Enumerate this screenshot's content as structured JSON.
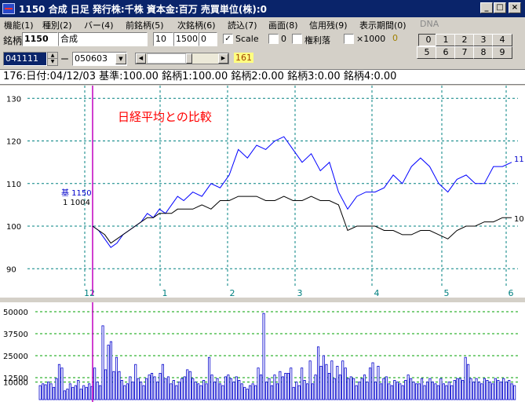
{
  "window": {
    "title": "1150 合成  日足    発行株:千株  資本金:百万  売買単位(株):0",
    "minimize_label": "_",
    "maximize_label": "□",
    "close_label": "×"
  },
  "menu": [
    "機能(1)",
    "種別(2)",
    "バー(4)",
    "前銘柄(5)",
    "次銘柄(6)",
    "読込(7)",
    "画面(8)",
    "信用残(9)",
    "表示期間(0)",
    "DNA"
  ],
  "toolbar": {
    "ticker_label": "銘柄",
    "ticker_code": "1150",
    "ticker_name": "合成",
    "field_a": "10",
    "field_b": "1500",
    "field_c": "0",
    "scale_label": "Scale",
    "scale_checked": "✓",
    "zero_label": "0",
    "rights_label": "権利落",
    "x1000_label": "×1000",
    "count_value": "0",
    "start_date": "041111",
    "dash": "ー",
    "end_date": "050603",
    "slider_value": "161",
    "number_buttons": [
      "0",
      "1",
      "2",
      "3",
      "4",
      "5",
      "6",
      "7",
      "8",
      "9"
    ]
  },
  "info": {
    "text": "176:日付:04/12/03  基準:100.00  銘柄1:100.00  銘柄2:0.00  銘柄3:0.00  銘柄4:0.00"
  },
  "colors": {
    "main_series": "#0000ff",
    "compare_series": "#000000",
    "cursor": "#c000c0",
    "annotation": "#ff0000",
    "grid": "#008080",
    "volume_grid": "#00a000"
  },
  "chart_data": [
    {
      "type": "line",
      "title": "日経平均との比較",
      "ylim": [
        86,
        133
      ],
      "y_ticks": [
        "130",
        "120",
        "110",
        "100",
        "90"
      ],
      "x_ticks": [
        "12",
        "1",
        "2",
        "3",
        "4",
        "5",
        "6"
      ],
      "x_sub_label": "5",
      "legend": [
        "基 1150",
        "1 1004"
      ],
      "end_labels": [
        "11",
        "10"
      ],
      "x_domain": [
        0,
        138
      ],
      "series": [
        {
          "name": "1150",
          "x": [
            0,
            2,
            4,
            6,
            8,
            10,
            12,
            14,
            16,
            18,
            20,
            22,
            24,
            26,
            28,
            30,
            33,
            36,
            39,
            42,
            45,
            48,
            51,
            54,
            57,
            60,
            63,
            66,
            69,
            72,
            75,
            78,
            81,
            84,
            87,
            90,
            93,
            96,
            99,
            102,
            105,
            108,
            111,
            114,
            117,
            120,
            123,
            126,
            129,
            132,
            135,
            138
          ],
          "values": [
            100,
            99,
            97,
            95,
            96,
            98,
            99,
            100,
            101,
            103,
            102,
            104,
            103,
            105,
            107,
            106,
            108,
            107,
            110,
            109,
            112,
            118,
            116,
            119,
            118,
            120,
            121,
            118,
            115,
            117,
            113,
            115,
            108,
            104,
            107,
            108,
            108,
            109,
            112,
            110,
            114,
            116,
            114,
            110,
            108,
            111,
            112,
            110,
            110,
            114,
            114,
            115
          ]
        },
        {
          "name": "1004",
          "x": [
            0,
            2,
            4,
            6,
            8,
            10,
            12,
            14,
            16,
            18,
            20,
            22,
            24,
            26,
            28,
            30,
            33,
            36,
            39,
            42,
            45,
            48,
            51,
            54,
            57,
            60,
            63,
            66,
            69,
            72,
            75,
            78,
            81,
            84,
            87,
            90,
            93,
            96,
            99,
            102,
            105,
            108,
            111,
            114,
            117,
            120,
            123,
            126,
            129,
            132,
            135,
            138
          ],
          "values": [
            100,
            99,
            98,
            96,
            97,
            98,
            99,
            100,
            101,
            102,
            102,
            103,
            103,
            103,
            104,
            104,
            104,
            105,
            104,
            106,
            106,
            107,
            107,
            107,
            106,
            106,
            107,
            106,
            106,
            107,
            106,
            106,
            105,
            99,
            100,
            100,
            100,
            99,
            99,
            98,
            98,
            99,
            99,
            98,
            97,
            99,
            100,
            100,
            101,
            101,
            102,
            102
          ]
        }
      ]
    },
    {
      "type": "bar",
      "ylim": [
        0,
        50000
      ],
      "y_ticks": [
        "50000",
        "37500",
        "25000",
        "12500",
        "10000"
      ],
      "values": [
        8000,
        9000,
        8500,
        10000,
        9000,
        7000,
        12000,
        20000,
        18000,
        5000,
        6000,
        9000,
        7000,
        8000,
        11000,
        6000,
        8000,
        7000,
        9000,
        7500,
        18000,
        10000,
        8000,
        42000,
        17000,
        31000,
        33000,
        16000,
        24000,
        16000,
        11000,
        8000,
        9000,
        13000,
        10000,
        20000,
        12000,
        10000,
        8000,
        12000,
        14000,
        15000,
        13000,
        10000,
        15000,
        20000,
        12000,
        13000,
        9000,
        11000,
        8000,
        10000,
        12000,
        13000,
        17000,
        16000,
        12000,
        10000,
        9000,
        8000,
        11000,
        9000,
        24000,
        14000,
        10000,
        12000,
        9000,
        8000,
        13000,
        14000,
        12000,
        10000,
        13000,
        11000,
        9000,
        7000,
        6000,
        8000,
        9000,
        8000,
        18000,
        14000,
        49000,
        10000,
        12000,
        8000,
        14000,
        9000,
        16000,
        13000,
        15000,
        15000,
        18000,
        7000,
        10000,
        8000,
        18000,
        11000,
        9000,
        22000,
        9000,
        14000,
        30000,
        19000,
        25000,
        20000,
        15000,
        22000,
        12000,
        19000,
        14000,
        22000,
        18000,
        12000,
        13000,
        12000,
        8000,
        10000,
        12000,
        14000,
        10000,
        18000,
        21000,
        10000,
        19000,
        9000,
        12000,
        13000,
        9000,
        8000,
        11000,
        10000,
        9000,
        8000,
        11000,
        14000,
        12000,
        10000,
        9000,
        9000,
        12000,
        8000,
        10000,
        12000,
        10000,
        9000,
        8000,
        12000,
        9000,
        8000,
        10000,
        8000,
        11000,
        12000,
        12000,
        11000,
        24000,
        20000,
        12000,
        10000,
        12000,
        10000,
        9000,
        12000,
        11000,
        10000,
        9000,
        12000,
        11000,
        10000,
        12000,
        10000,
        11000,
        9000,
        8000
      ]
    }
  ]
}
